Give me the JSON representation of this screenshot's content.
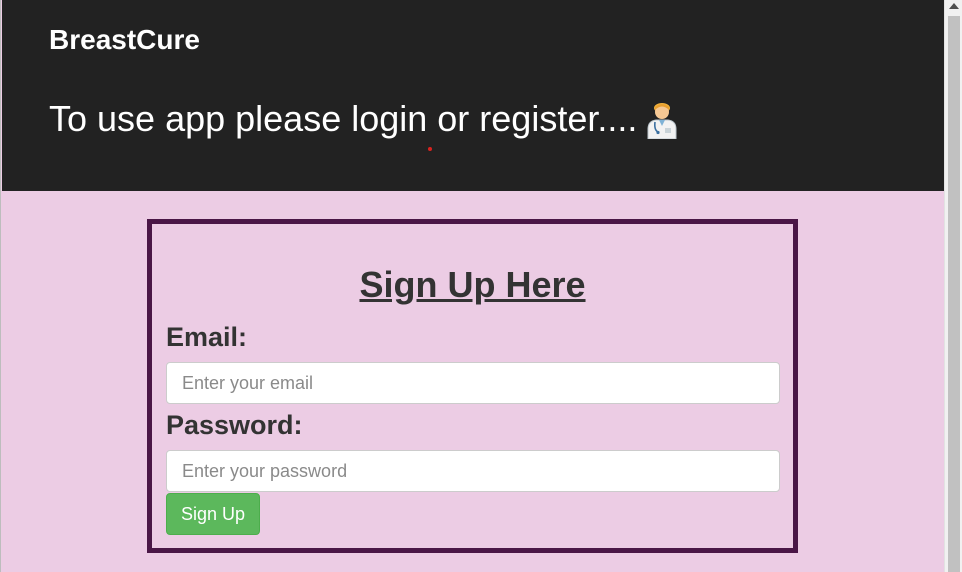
{
  "header": {
    "brand": "BreastCure",
    "prompt": "To use app please login or register....",
    "prompt_icon": "doctor-emoji-icon"
  },
  "signup": {
    "title": "Sign Up Here",
    "email_label": "Email:",
    "email_placeholder": "Enter your email",
    "email_value": "",
    "password_label": "Password:",
    "password_placeholder": "Enter your password",
    "password_value": "",
    "submit_label": "Sign Up"
  },
  "colors": {
    "header_bg": "#222222",
    "page_bg": "#eccce4",
    "card_border": "#4a1646",
    "button_bg": "#5cb85c"
  }
}
